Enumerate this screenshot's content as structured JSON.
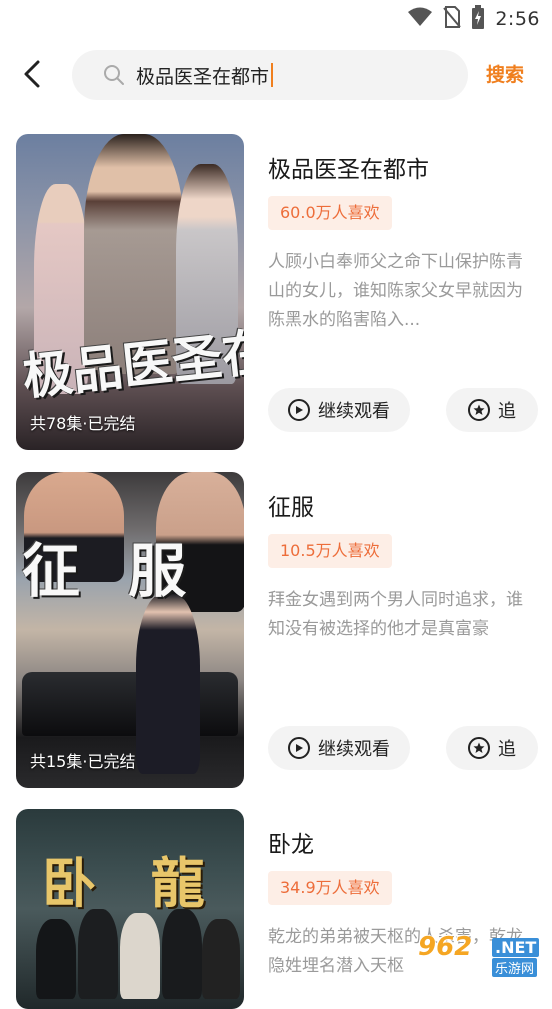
{
  "status_bar": {
    "time": "2:56",
    "icons": [
      "wifi-icon",
      "no-sim-icon",
      "battery-charging-icon"
    ]
  },
  "header": {
    "back_icon": "chevron-left-icon",
    "search_icon": "search-icon",
    "search_value": "极品医圣在都市",
    "search_button": "搜索"
  },
  "results": [
    {
      "poster_title": "极品医圣在都市",
      "episodes": "共78集·已完结",
      "title": "极品医圣在都市",
      "likes": "60.0万人喜欢",
      "description": "人顾小白奉师父之命下山保护陈青山的女儿，谁知陈家父女早就因为陈黑水的陷害陷入...",
      "watch_label": "继续观看",
      "follow_label": "追"
    },
    {
      "poster_title": "征 服",
      "episodes": "共15集·已完结",
      "title": "征服",
      "likes": "10.5万人喜欢",
      "description": "拜金女遇到两个男人同时追求，谁知没有被选择的他才是真富豪",
      "watch_label": "继续观看",
      "follow_label": "追"
    },
    {
      "poster_title": "卧 龍",
      "episodes": "",
      "title": "卧龙",
      "likes": "34.9万人喜欢",
      "description": "乾龙的弟弟被天枢的人杀害，乾龙隐姓埋名潜入天枢",
      "watch_label": "",
      "follow_label": ""
    }
  ],
  "watermark": {
    "number": "962",
    "net": ".NET",
    "site": "乐游网"
  },
  "colors": {
    "accent": "#f07f1e",
    "likes_text": "#ed6d3a",
    "likes_bg": "#fdeee6",
    "desc_text": "#9a9a9a"
  }
}
